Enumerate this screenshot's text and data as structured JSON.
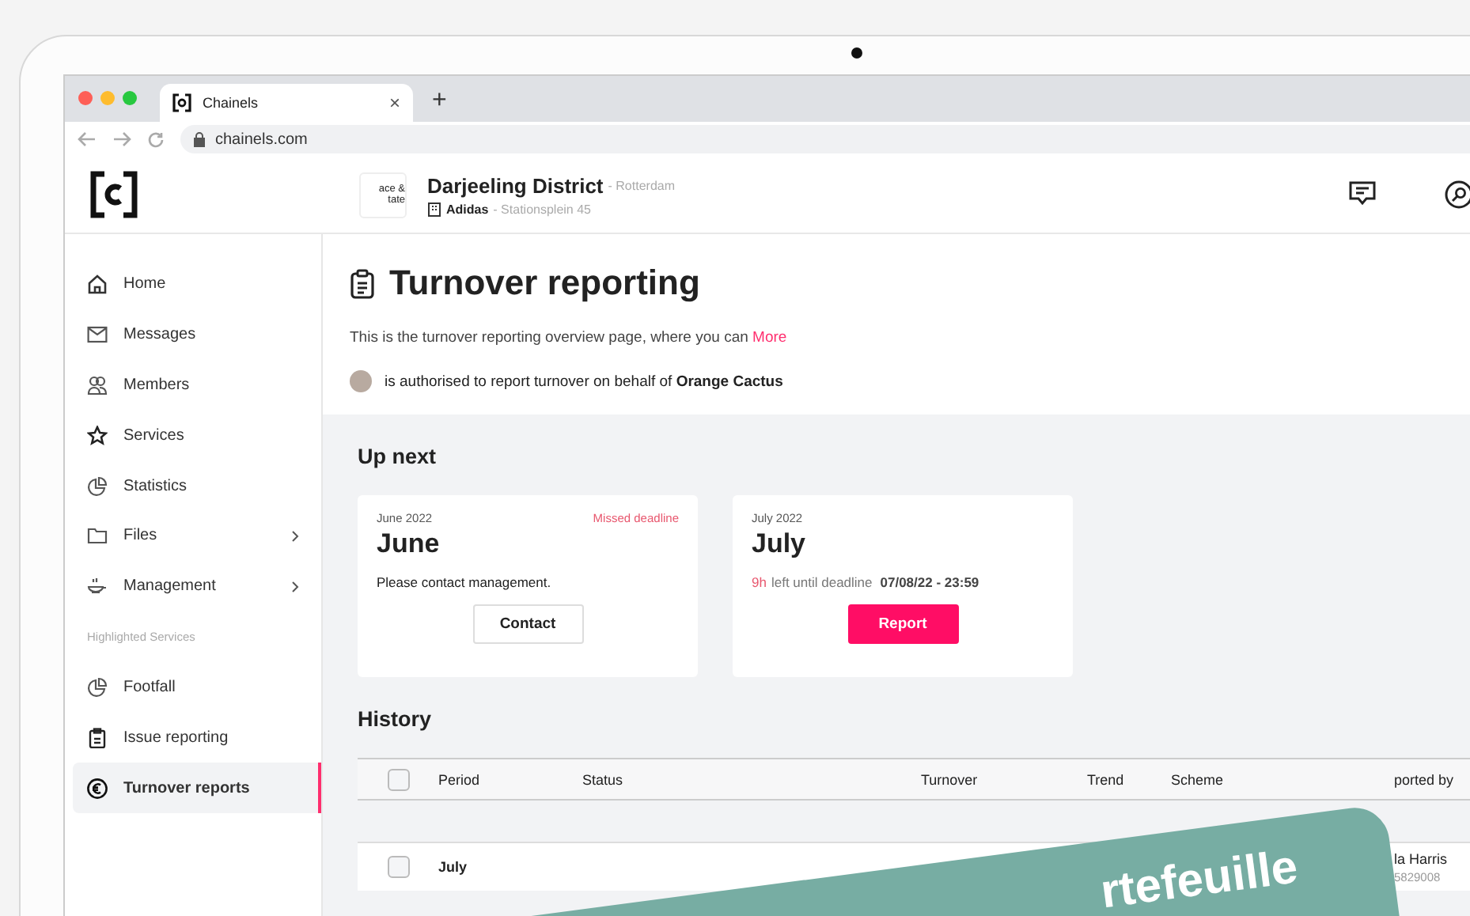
{
  "browser": {
    "tab_title": "Chainels",
    "tab_close": "×",
    "new_tab": "+",
    "url": "chainels.com"
  },
  "header": {
    "logo_text": "ace & tate",
    "title": "Darjeeling District",
    "city": "- Rotterdam",
    "company": "Adidas",
    "address": "- Stationsplein 45"
  },
  "sidebar": {
    "items": [
      {
        "kind": "item",
        "label": "Home",
        "expandable": false,
        "selected": false
      },
      {
        "kind": "item",
        "label": "Messages",
        "expandable": false,
        "selected": false
      },
      {
        "kind": "item",
        "label": "Members",
        "expandable": false,
        "selected": false
      },
      {
        "kind": "item",
        "label": "Services",
        "expandable": false,
        "selected": false
      },
      {
        "kind": "item",
        "label": "Statistics",
        "expandable": false,
        "selected": false
      },
      {
        "kind": "item",
        "label": "Files",
        "expandable": true,
        "selected": false
      },
      {
        "kind": "item",
        "label": "Management",
        "expandable": true,
        "selected": false
      },
      {
        "kind": "heading",
        "label": "Highlighted Services"
      },
      {
        "kind": "item",
        "label": "Footfall",
        "expandable": false,
        "selected": false
      },
      {
        "kind": "item",
        "label": "Issue reporting",
        "expandable": false,
        "selected": false
      },
      {
        "kind": "item",
        "label": "Turnover reports",
        "expandable": false,
        "selected": true
      }
    ]
  },
  "page": {
    "title": "Turnover reporting",
    "intro": "This is the turnover reporting overview page, where you can",
    "more_link": "More",
    "authorised_text": "is authorised to report turnover on behalf of",
    "authorised_org": "Orange Cactus"
  },
  "up_next": {
    "heading": "Up next",
    "cards": [
      {
        "kind": "missed",
        "period": "June 2022",
        "month": "June",
        "badge": "Missed deadline",
        "message": "Please contact management.",
        "button": "Contact"
      },
      {
        "kind": "open",
        "period": "July 2022",
        "month": "July",
        "time_left": "9h",
        "left_text": "left until deadline",
        "deadline": "07/08/22 - 23:59",
        "button": "Report"
      }
    ]
  },
  "history": {
    "heading": "History",
    "columns": [
      "Period",
      "Status",
      "Turnover",
      "Trend",
      "Scheme",
      "ported by"
    ],
    "header_checked": false,
    "rows": [
      {
        "period": "July",
        "checked": false,
        "reporter": "la Harris",
        "reporter_id": "5829008"
      }
    ]
  },
  "overlay_card": {
    "text": "rtefeuille"
  }
}
